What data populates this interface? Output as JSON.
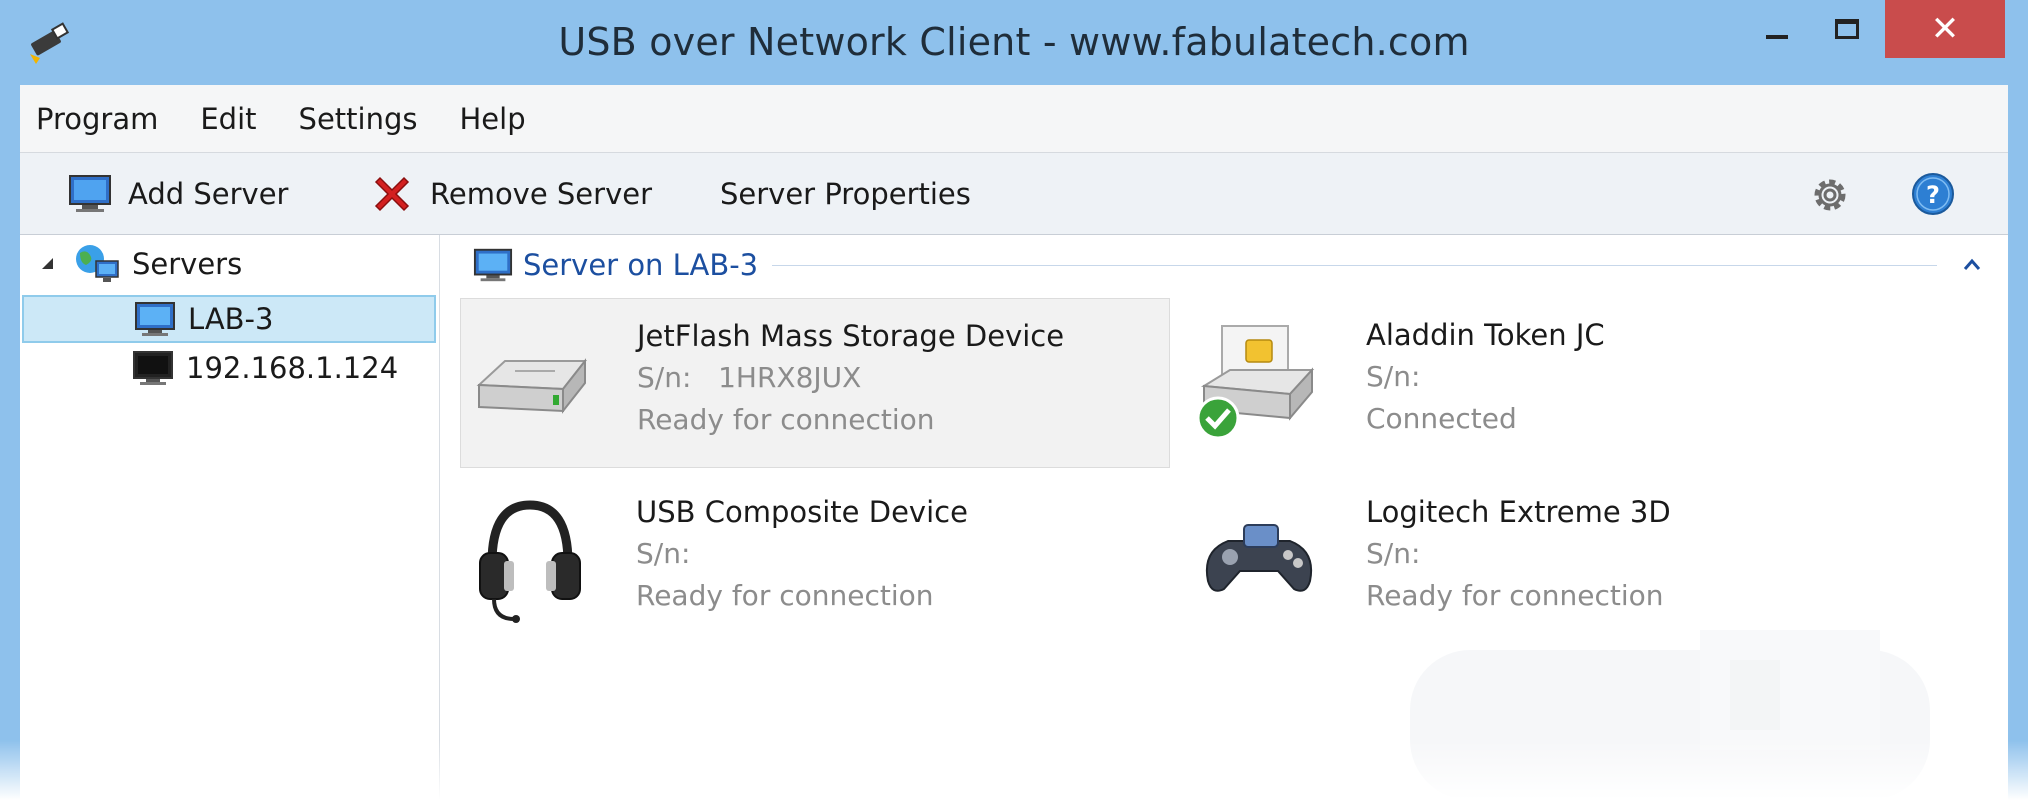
{
  "window": {
    "title": "USB over Network Client - www.fabulatech.com",
    "close_glyph": "✕"
  },
  "menubar": {
    "items": [
      {
        "label": "Program"
      },
      {
        "label": "Edit"
      },
      {
        "label": "Settings"
      },
      {
        "label": "Help"
      }
    ]
  },
  "toolbar": {
    "add_server": "Add Server",
    "remove_server": "Remove Server",
    "server_properties": "Server Properties",
    "settings_icon": "gear-icon",
    "help_icon": "help-icon"
  },
  "tree": {
    "root_label": "Servers",
    "servers": [
      {
        "label": "LAB-3",
        "selected": true
      },
      {
        "label": "192.168.1.124",
        "selected": false
      }
    ]
  },
  "content": {
    "group_title": "Server on LAB-3",
    "devices": [
      {
        "name": "JetFlash Mass Storage Device",
        "sn_label": "S/n:",
        "sn": "1HRX8JUX",
        "status": "Ready for connection",
        "icon": "usb-drive-icon",
        "selected": true
      },
      {
        "name": "Aladdin Token JC",
        "sn_label": "S/n:",
        "sn": "",
        "status": "Connected",
        "icon": "smartcard-reader-icon",
        "selected": false
      },
      {
        "name": "USB Composite Device",
        "sn_label": "S/n:",
        "sn": "",
        "status": "Ready for connection",
        "icon": "headset-icon",
        "selected": false
      },
      {
        "name": "Logitech Extreme 3D",
        "sn_label": "S/n:",
        "sn": "",
        "status": "Ready for connection",
        "icon": "gamepad-icon",
        "selected": false
      }
    ]
  },
  "colors": {
    "titlebar": "#8ec1ec",
    "close_button": "#c94c4c",
    "group_title": "#1c4fa0",
    "selection": "#cce8f7"
  }
}
